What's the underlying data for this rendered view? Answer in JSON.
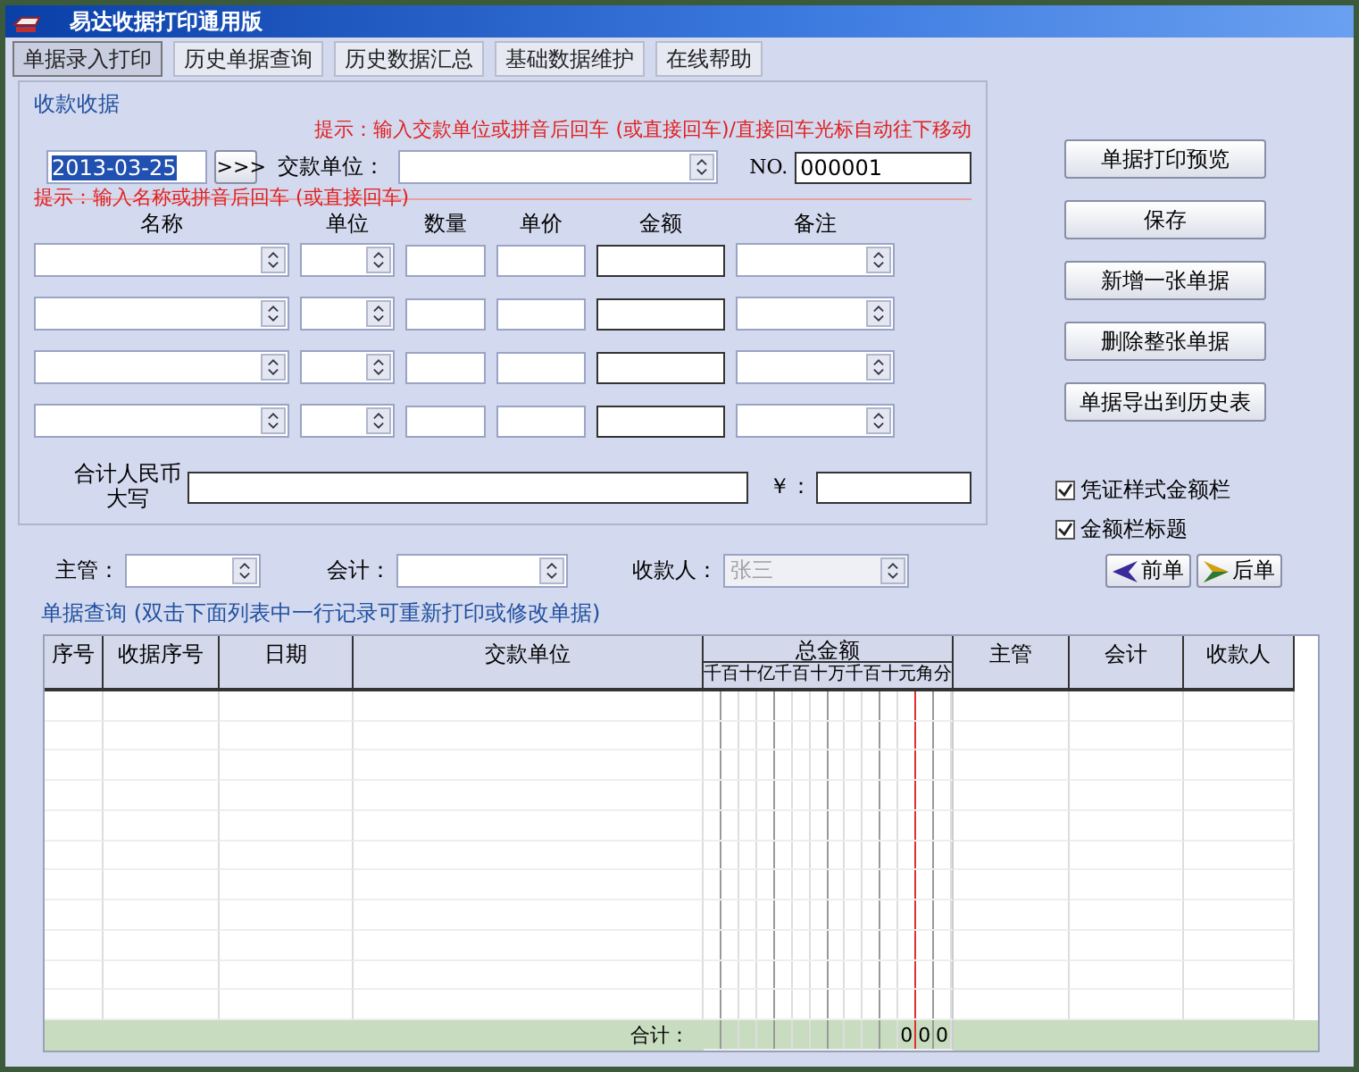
{
  "window": {
    "title": "易达收据打印通用版"
  },
  "tabs": [
    {
      "label": "单据录入打印",
      "selected": true
    },
    {
      "label": "历史单据查询",
      "selected": false
    },
    {
      "label": "历史数据汇总",
      "selected": false
    },
    {
      "label": "基础数据维护",
      "selected": false
    },
    {
      "label": "在线帮助",
      "selected": false
    }
  ],
  "receipt": {
    "title": "收款收据",
    "hint_top": "提示：输入交款单位或拼音后回车 (或直接回车)/直接回车光标自动往下移动",
    "date": {
      "value": "2013-03-25",
      "highlighted": true
    },
    "date_button": ">>>",
    "payer_label": "交款单位：",
    "no_label": "NO.",
    "no_value": "000001",
    "hint_items": "提示：输入名称或拼音后回车 (或直接回车)",
    "columns": [
      "名称",
      "单位",
      "数量",
      "单价",
      "金额",
      "备注"
    ],
    "total_label": "合计人民币大写",
    "yuan_label": "￥："
  },
  "actions": [
    "单据打印预览",
    "保存",
    "新增一张单据",
    "删除整张单据",
    "单据导出到历史表"
  ],
  "options": [
    {
      "label": "凭证样式金额栏",
      "checked": true
    },
    {
      "label": "金额栏标题",
      "checked": true
    }
  ],
  "signers": [
    {
      "label": "主管：",
      "disabled": false
    },
    {
      "label": "会计：",
      "disabled": false
    },
    {
      "label": "收款人：",
      "value": "张三",
      "disabled": true
    }
  ],
  "nav": [
    {
      "label": "前单",
      "kind": "prev"
    },
    {
      "label": "后单",
      "kind": "next"
    }
  ],
  "query": {
    "title": "单据查询 (双击下面列表中一行记录可重新打印或修改单据)",
    "columns": [
      "序号",
      "收据序号",
      "日期",
      "交款单位"
    ],
    "amount_header": "总金额",
    "amount_units": [
      "千",
      "百",
      "十",
      "亿",
      "千",
      "百",
      "十",
      "万",
      "千",
      "百",
      "十",
      "元",
      "角",
      "分"
    ],
    "columns_after": [
      "主管",
      "会计",
      "收款人"
    ],
    "total_label": "合计：",
    "total_digits": [
      "0",
      "0",
      "0"
    ]
  }
}
